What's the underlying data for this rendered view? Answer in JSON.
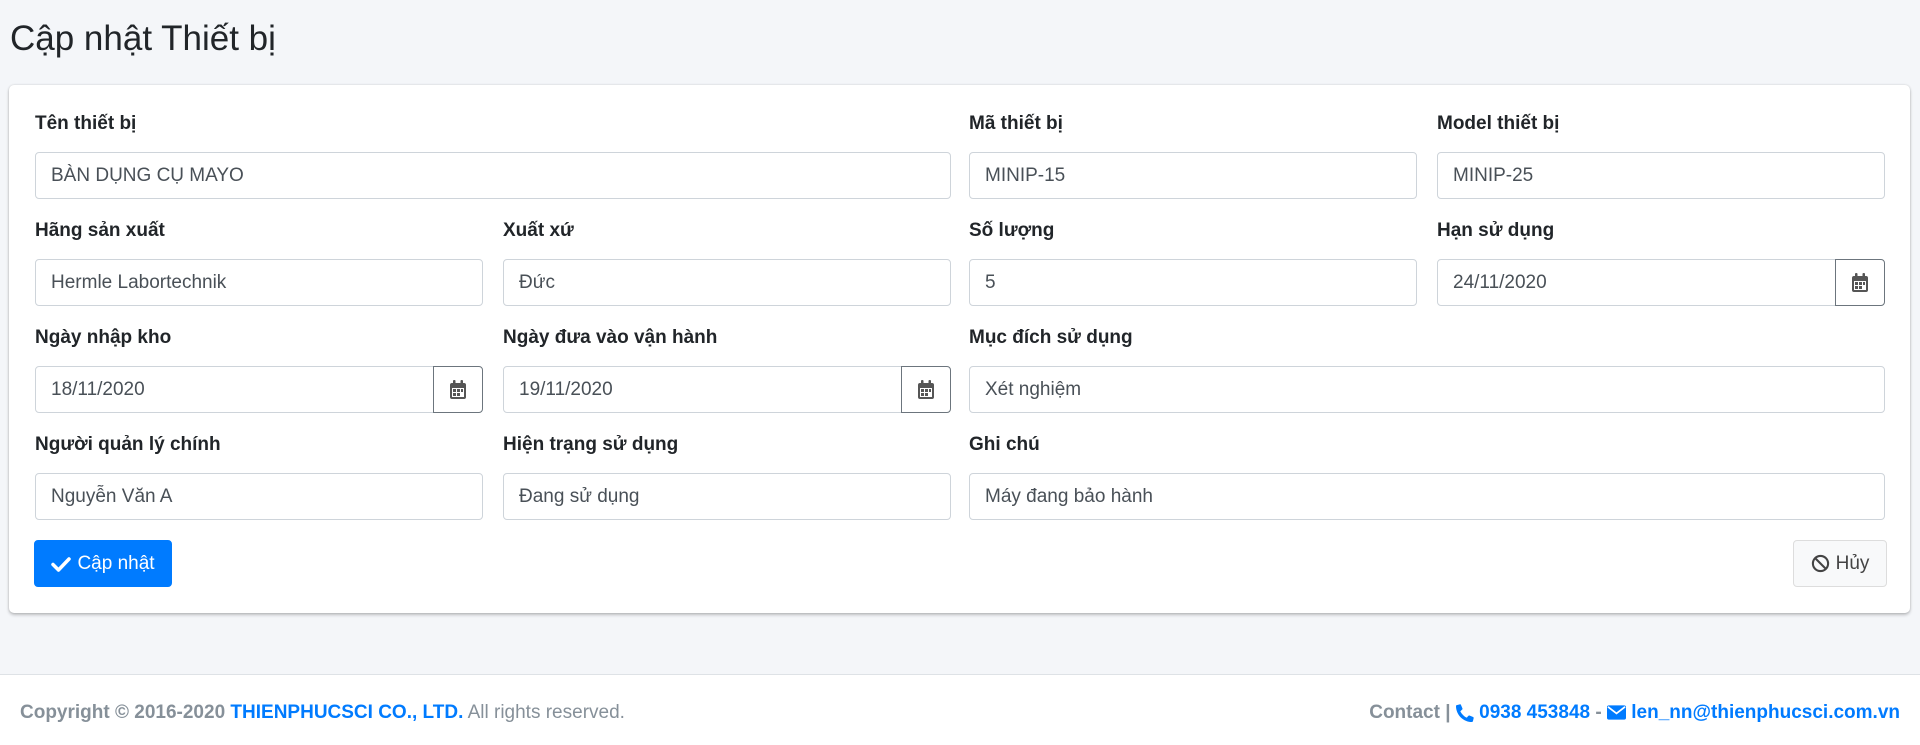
{
  "page": {
    "title": "Cập nhật Thiết bị"
  },
  "form": {
    "ten_thiet_bi": {
      "label": "Tên thiết bị",
      "value": "BÀN DỤNG CỤ MAYO"
    },
    "ma_thiet_bi": {
      "label": "Mã thiết bị",
      "value": "MINIP-15"
    },
    "model_thiet_bi": {
      "label": "Model thiết bị",
      "value": "MINIP-25"
    },
    "hang_san_xuat": {
      "label": "Hãng sản xuất",
      "value": "Hermle Labortechnik"
    },
    "xuat_xu": {
      "label": "Xuất xứ",
      "value": "Đức"
    },
    "so_luong": {
      "label": "Số lượng",
      "value": "5"
    },
    "han_su_dung": {
      "label": "Hạn sử dụng",
      "value": "24/11/2020"
    },
    "ngay_nhap_kho": {
      "label": "Ngày nhập kho",
      "value": "18/11/2020"
    },
    "ngay_dua_vao_van_hanh": {
      "label": "Ngày đưa vào vận hành",
      "value": "19/11/2020"
    },
    "muc_dich_su_dung": {
      "label": "Mục đích sử dụng",
      "value": "Xét nghiệm"
    },
    "nguoi_quan_ly_chinh": {
      "label": "Người quản lý chính",
      "value": "Nguyễn Văn A"
    },
    "hien_trang_su_dung": {
      "label": "Hiện trạng sử dụng",
      "value": "Đang sử dụng"
    },
    "ghi_chu": {
      "label": "Ghi chú",
      "value": "Máy đang bảo hành"
    }
  },
  "actions": {
    "update_label": "Cập nhật",
    "cancel_label": "Hủy"
  },
  "footer": {
    "copyright": "Copyright © 2016-2020",
    "company": "THIENPHUCSCI CO., LTD.",
    "rights": "All rights reserved.",
    "contact_label": "Contact |",
    "phone": "0938 453848",
    "separator": "-",
    "email": "len_nn@thienphucsci.com.vn"
  },
  "colors": {
    "primary": "#007bff",
    "background": "#f4f6f9",
    "text_muted": "#869099"
  }
}
